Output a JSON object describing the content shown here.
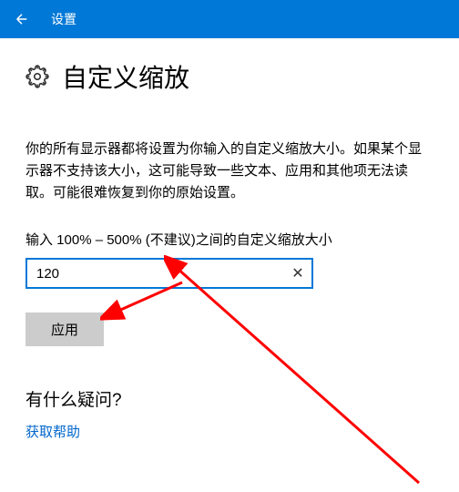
{
  "header": {
    "title": "设置"
  },
  "page": {
    "heading": "自定义缩放",
    "description": "你的所有显示器都将设置为你输入的自定义缩放大小。如果某个显示器不支持该大小，这可能导致一些文本、应用和其他项无法读取。可能很难恢复到你的原始设置。",
    "input_label": "输入 100% – 500% (不建议)之间的自定义缩放大小",
    "scale_value": "120",
    "apply_label": "应用"
  },
  "help": {
    "heading": "有什么疑问?",
    "link_label": "获取帮助"
  }
}
